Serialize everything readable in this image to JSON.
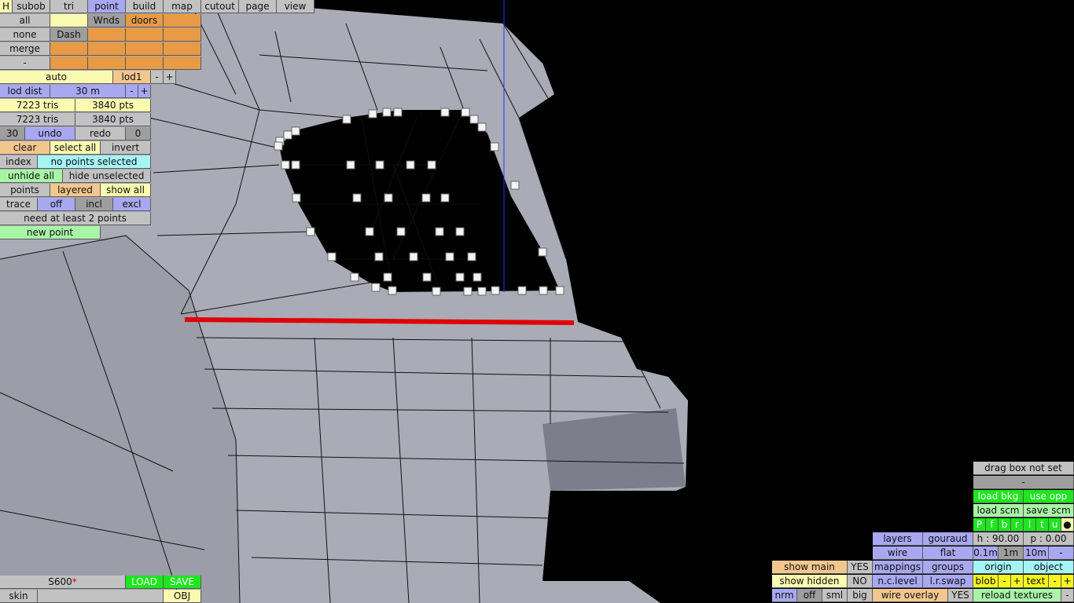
{
  "top_bar": [
    "H",
    "subob",
    "tri",
    "point",
    "build",
    "map",
    "cutout",
    "page",
    "view"
  ],
  "left_panel": {
    "select_all": "all",
    "select_none": "none",
    "merge": "merge",
    "dash": "-",
    "wnds": "Wnds",
    "doors": "doors",
    "dash_btn": "Dash",
    "auto": "auto",
    "lod": "lod1",
    "minus": "-",
    "plus": "+",
    "lod_dist_label": "lod dist",
    "lod_dist_value": "30 m",
    "tris1": "7223 tris",
    "pts1": "3840 pts",
    "tris2": "7223 tris",
    "pts2": "3840 pts",
    "undo_count": "30",
    "undo": "undo",
    "redo": "redo",
    "redo_count": "0",
    "clear": "clear",
    "select_all_btn": "select all",
    "invert": "invert",
    "index": "index",
    "selection_status": "no points selected",
    "unhide_all": "unhide all",
    "hide_unselected": "hide unselected",
    "points": "points",
    "layered": "layered",
    "show_all": "show all",
    "trace": "trace",
    "trace_off": "off",
    "trace_incl": "incl",
    "trace_excl": "excl",
    "need_points": "need at least 2 points",
    "new_point": "new point"
  },
  "file_bar": {
    "filename": "S600",
    "modified_mark": "*",
    "load": "LOAD",
    "save": "SAVE",
    "skin": "skin",
    "obj": "OBJ"
  },
  "right_panel": {
    "drag_box": "drag box not set",
    "dash": "-",
    "load_bkg": "load bkg",
    "use_opp": "use opp",
    "load_scm": "load scm",
    "save_scm": "save scm",
    "view_keys": [
      "P",
      "f",
      "b",
      "r",
      "l",
      "t",
      "u",
      "●"
    ],
    "h": "h : 90.00",
    "p": "p : 0.00",
    "step_01": "0.1m",
    "step_1": "1m",
    "step_10": "10m",
    "step_minus": "-",
    "origin": "origin",
    "object": "object",
    "blob": "blob",
    "text": "text",
    "minus": "-",
    "plus": "+",
    "reload_textures": "reload textures"
  },
  "render_panel": {
    "layers": "layers",
    "gouraud": "gouraud",
    "wire": "wire",
    "flat": "flat",
    "mappings": "mappings",
    "groups": "groups",
    "nc_level": "n.c.level",
    "lr_swap": "l.r.swap",
    "show_main": "show main",
    "show_main_val": "YES",
    "show_hidden": "show hidden",
    "show_hidden_val": "NO",
    "nrm": "nrm",
    "off": "off",
    "sml": "sml",
    "big": "big",
    "wire_overlay": "wire overlay",
    "wire_overlay_val": "YES"
  },
  "colors": {
    "mesh": "#a9abb6",
    "accent_line": "#e00000",
    "guide": "#3030ff"
  }
}
